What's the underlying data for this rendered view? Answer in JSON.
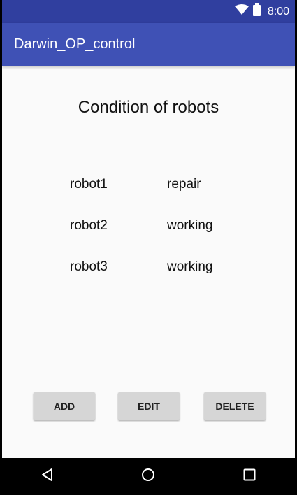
{
  "status_bar": {
    "time": "8:00",
    "icons": [
      "wifi-icon",
      "battery-icon"
    ]
  },
  "app_bar": {
    "title": "Darwin_OP_control",
    "color": "#3F51B5",
    "status_color": "#303F9F"
  },
  "main": {
    "title": "Condition of robots",
    "robots": [
      {
        "name": "robot1",
        "status": "repair"
      },
      {
        "name": "robot2",
        "status": "working"
      },
      {
        "name": "robot3",
        "status": "working"
      }
    ]
  },
  "buttons": {
    "add": "ADD",
    "edit": "EDIT",
    "delete": "DELETE"
  },
  "nav_bar": {
    "icons": [
      "back-icon",
      "home-icon",
      "recents-icon"
    ]
  }
}
